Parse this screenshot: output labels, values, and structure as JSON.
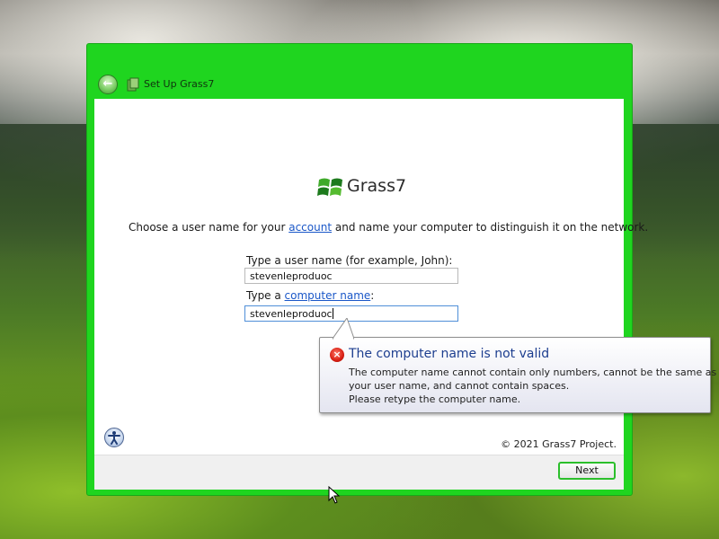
{
  "window": {
    "title": "Set Up Grass7"
  },
  "logo": {
    "text": "Grass7"
  },
  "instruction": {
    "before": "Choose a user name for your ",
    "link1": "account",
    "middle": " and name your computer to distinguish it on the network."
  },
  "username": {
    "label": "Type a user name (for example, John):",
    "value": "stevenleproduoc"
  },
  "computername": {
    "label_prefix": "Type a ",
    "label_link": "computer name",
    "label_suffix": ":",
    "value": "stevenleproduoc"
  },
  "error": {
    "title": "The computer name is not valid",
    "lines": [
      "The computer name cannot contain only numbers, cannot be the same as",
      "your user name, and cannot contain spaces.",
      "Please retype the computer name."
    ]
  },
  "copyright": "© 2021 Grass7 Project.",
  "buttons": {
    "next": "Next"
  },
  "icons": {
    "back": "back-arrow-icon",
    "app": "setup-icon",
    "logo": "grass7-flag-icon",
    "help": "ease-of-access-icon",
    "error": "error-icon",
    "cursor": "mouse-cursor-icon"
  },
  "colors": {
    "window_frame": "#1fd51f",
    "link": "#1a57c8",
    "error_title": "#1d3e8f",
    "next_border": "#2bbf2b"
  }
}
